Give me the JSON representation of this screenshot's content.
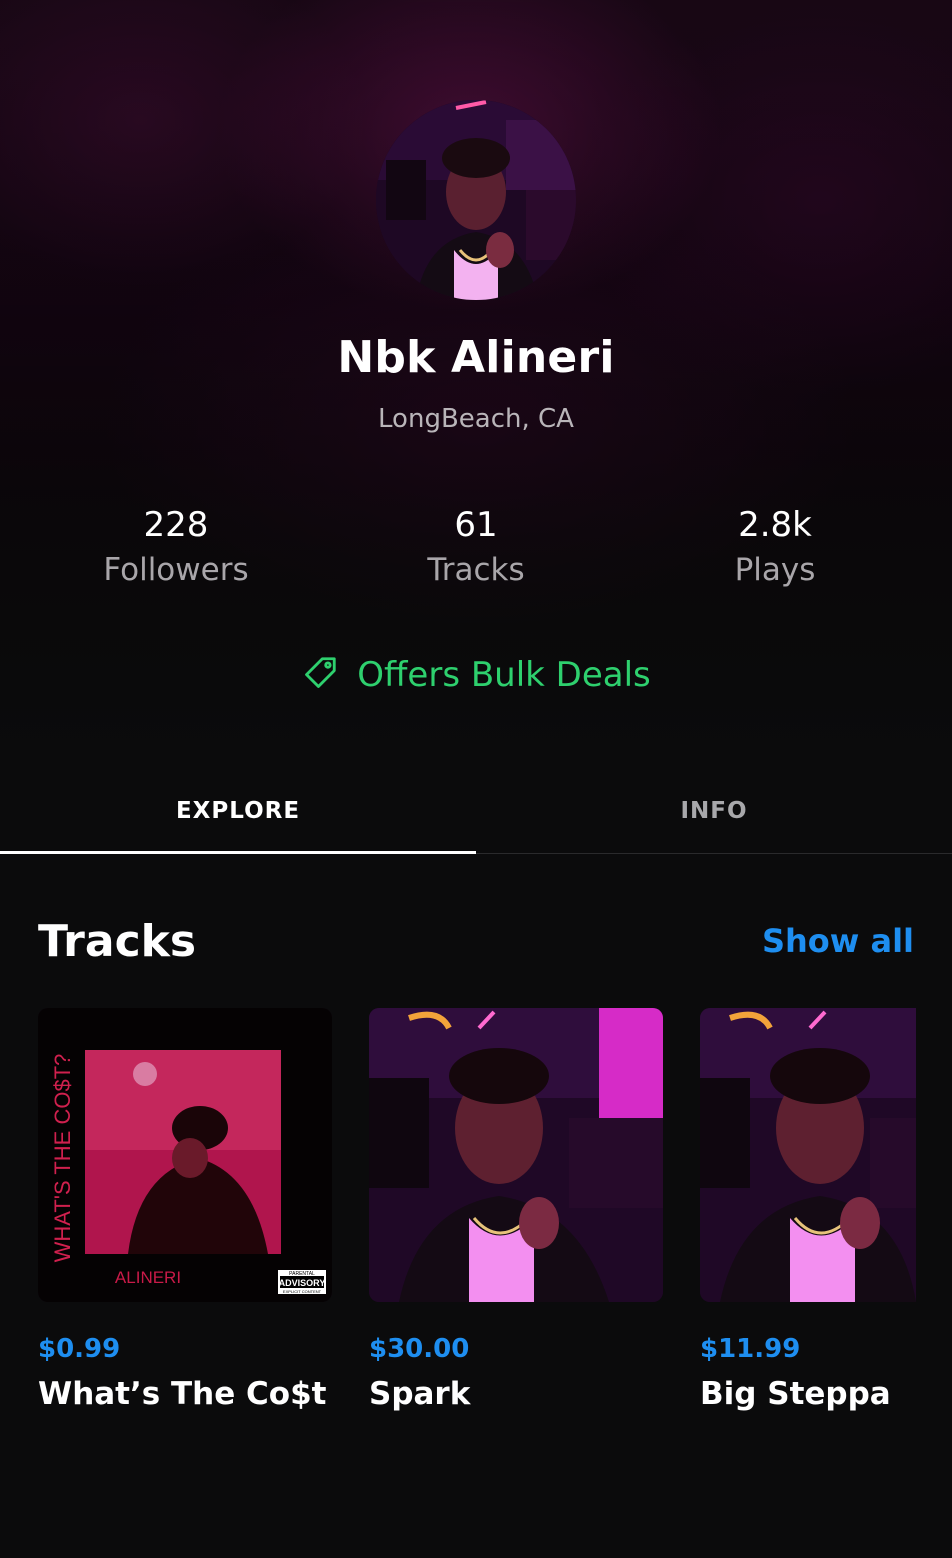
{
  "artist": {
    "name": "Nbk Alineri",
    "location": "LongBeach, CA"
  },
  "stats": [
    {
      "value": "228",
      "label": "Followers"
    },
    {
      "value": "61",
      "label": "Tracks"
    },
    {
      "value": "2.8k",
      "label": "Plays"
    }
  ],
  "bulk_deals": {
    "icon": "tag-icon",
    "label": "Offers Bulk Deals",
    "color": "#2ed06e"
  },
  "tabs": [
    {
      "label": "EXPLORE",
      "active": true
    },
    {
      "label": "INFO",
      "active": false
    }
  ],
  "tracks_section": {
    "title": "Tracks",
    "show_all_label": "Show all",
    "accent_color": "#1e8ef0",
    "items": [
      {
        "price": "$0.99",
        "title": "What’s The Co$t",
        "cover_text": {
          "vertical": "WHAT'S THE CO$T?",
          "artist": "ALINERI",
          "badge_top": "PARENTAL",
          "badge_main": "ADVISORY",
          "badge_bottom": "EXPLICIT CONTENT"
        }
      },
      {
        "price": "$30.00",
        "title": "Spark"
      },
      {
        "price": "$11.99",
        "title": "Big Steppa"
      }
    ]
  }
}
